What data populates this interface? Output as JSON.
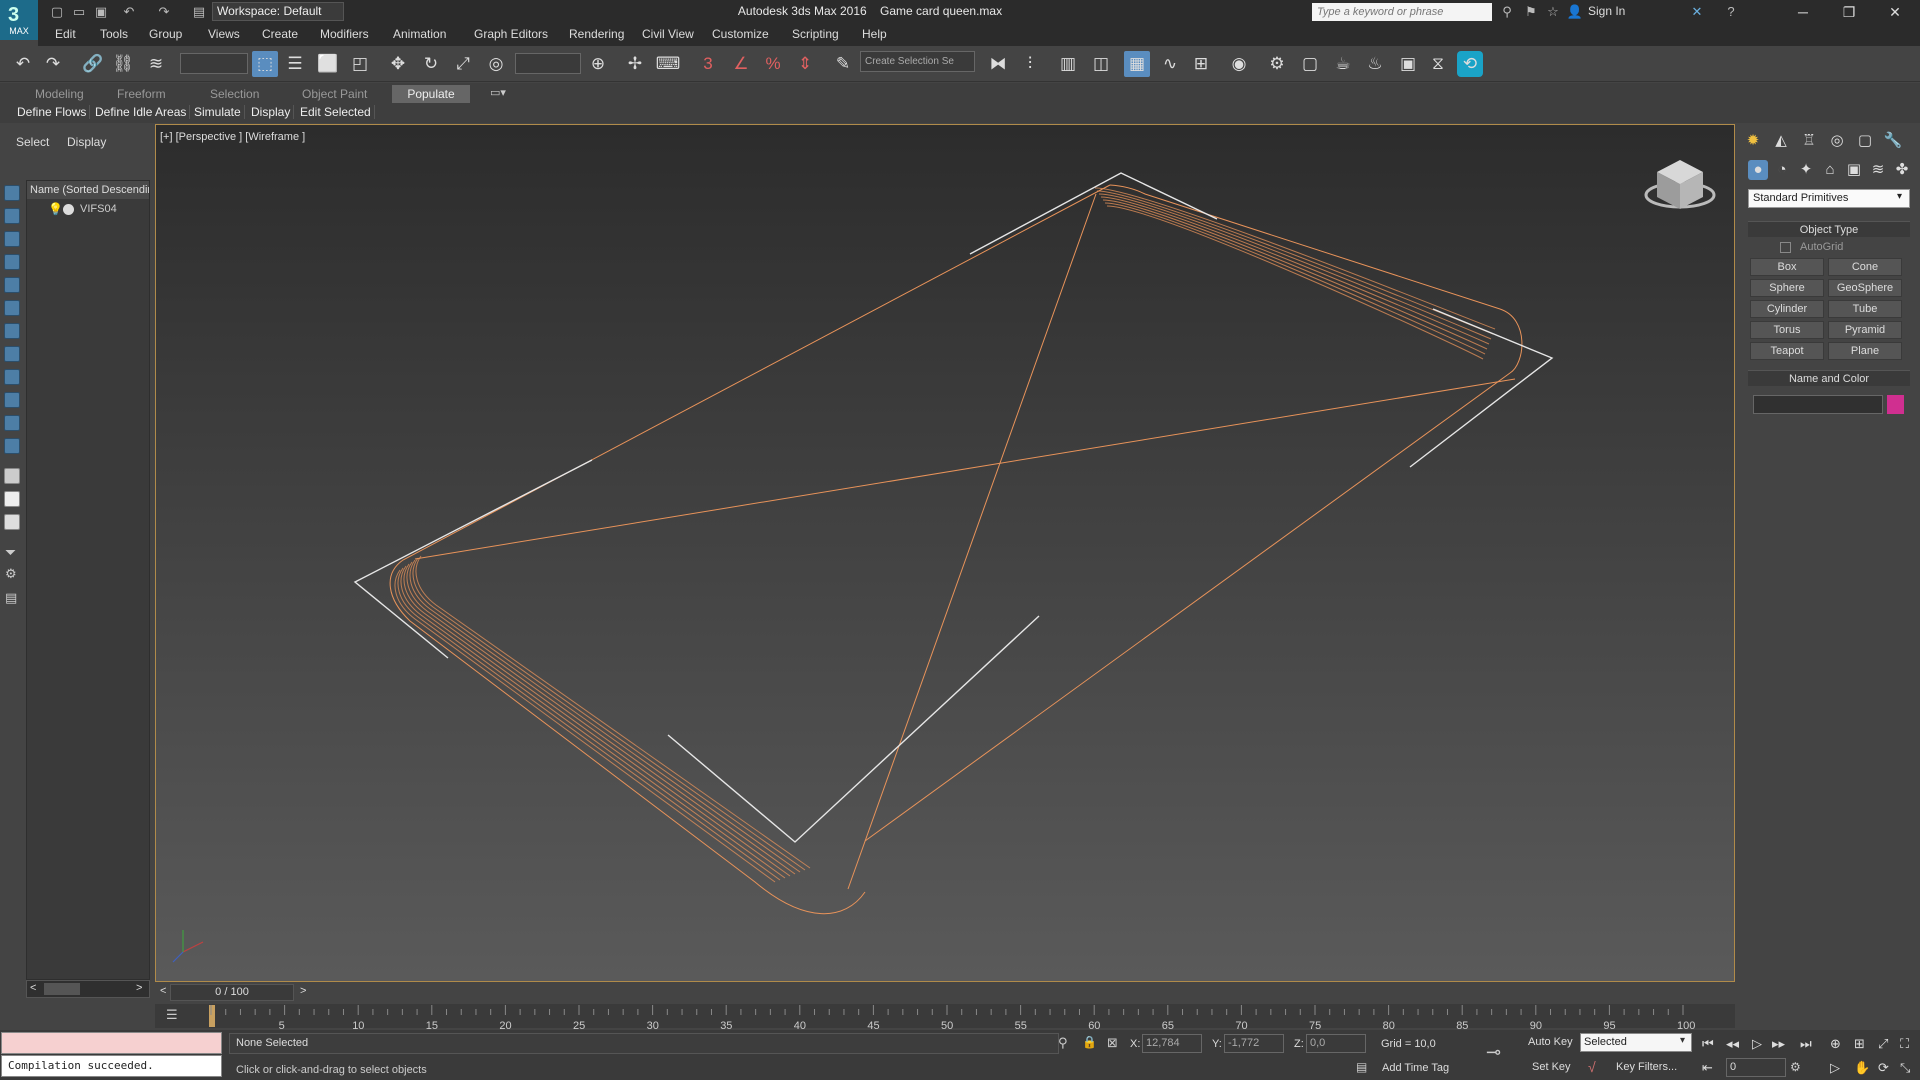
{
  "titlebar": {
    "workspace": "Workspace: Default",
    "app_title": "Autodesk 3ds Max 2016",
    "file_name": "Game card queen.max",
    "search_placeholder": "Type a keyword or phrase",
    "sign_in": "Sign In",
    "logo_text": "MAX"
  },
  "menu": [
    "Edit",
    "Tools",
    "Group",
    "Views",
    "Create",
    "Modifiers",
    "Animation",
    "Graph Editors",
    "Rendering",
    "Civil View",
    "Customize",
    "Scripting",
    "Help"
  ],
  "toolbar": {
    "selection_set_placeholder": "Create Selection Se"
  },
  "ribbon": {
    "tabs": [
      "Modeling",
      "Freeform",
      "Selection",
      "Object Paint",
      "Populate"
    ],
    "active_tab": "Populate",
    "buttons": [
      "Define Flows",
      "Define Idle Areas",
      "Simulate",
      "Display",
      "Edit Selected"
    ]
  },
  "scene_explorer": {
    "tabs": [
      "Select",
      "Display"
    ],
    "column_header": "Name (Sorted Descendin",
    "items": [
      "VIFS04"
    ]
  },
  "viewport": {
    "label": "[+] [Perspective ] [Wireframe ]"
  },
  "command_panel": {
    "dropdown": "Standard Primitives",
    "object_type_title": "Object Type",
    "autogrid": "AutoGrid",
    "primitives": [
      "Box",
      "Cone",
      "Sphere",
      "GeoSphere",
      "Cylinder",
      "Tube",
      "Torus",
      "Pyramid",
      "Teapot",
      "Plane"
    ],
    "name_color_title": "Name and Color",
    "object_color": "#d02f90"
  },
  "timeline": {
    "slider": "0 / 100",
    "ticks": [
      "5",
      "10",
      "15",
      "20",
      "25",
      "30",
      "35",
      "40",
      "45",
      "50",
      "55",
      "60",
      "65",
      "70",
      "75",
      "80",
      "85",
      "90",
      "95",
      "100"
    ]
  },
  "status": {
    "listener_output": "Compilation succeeded.",
    "selection": "None Selected",
    "prompt": "Click or click-and-drag to select objects",
    "x_label": "X:",
    "x": "12,784",
    "y_label": "Y:",
    "y": "-1,772",
    "z_label": "Z:",
    "z": "0,0",
    "grid": "Grid = 10,0",
    "add_time_tag": "Add Time Tag",
    "auto_key": "Auto Key",
    "set_key": "Set Key",
    "selected_dropdown": "Selected",
    "key_filters": "Key Filters...",
    "frame": "0"
  },
  "colors": {
    "wire_orange": "#e8935a",
    "viewport_border": "#b08b4a",
    "active_tool": "#5a8dbf"
  }
}
